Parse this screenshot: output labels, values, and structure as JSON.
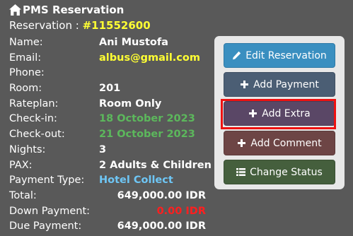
{
  "header": {
    "title": "PMS Reservation",
    "reservation_label": "Reservation : ",
    "reservation_number": "#11552600"
  },
  "details": {
    "name_label": "Name:",
    "name_value": "Ani Mustofa",
    "email_label": "Email:",
    "email_value": "albus@gmail.com",
    "phone_label": "Phone:",
    "phone_value": "",
    "room_label": "Room:",
    "room_value": "201",
    "rateplan_label": "Rateplan:",
    "rateplan_value": "Room Only",
    "checkin_label": "Check-in:",
    "checkin_value": "18 October 2023",
    "checkout_label": "Check-out:",
    "checkout_value": "21 October 2023",
    "nights_label": "Nights:",
    "nights_value": "3",
    "pax_label": "PAX:",
    "pax_value": "2 Adults & Children",
    "payment_type_label": "Payment Type:",
    "payment_type_value": "Hotel Collect",
    "total_label": "Total:",
    "total_value": "649,000.00 IDR",
    "down_payment_label": "Down Payment:",
    "down_payment_value": "0.00 IDR",
    "due_payment_label": "Due Payment:",
    "due_payment_value": "649,000.00 IDR"
  },
  "actions": {
    "edit_reservation": "Edit Reservation",
    "add_payment": "Add Payment",
    "add_extra": "Add Extra",
    "add_comment": "Add Comment",
    "change_status": "Change Status"
  },
  "icons": {
    "title": "home-icon",
    "edit": "pencil-icon",
    "add": "plus-icon",
    "status": "list-icon"
  },
  "colors": {
    "background": "#595959",
    "reservation_number": "#ffff33",
    "dates": "#5cb85c",
    "payment_type": "#6ec6f5",
    "down_payment": "#ff1f1f",
    "highlight": "#ee1111"
  }
}
